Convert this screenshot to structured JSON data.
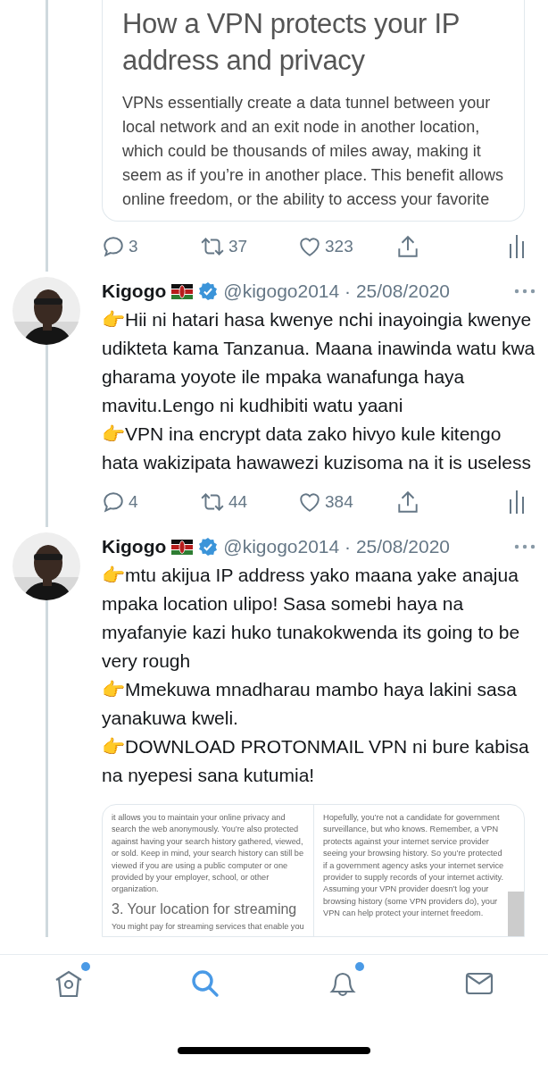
{
  "top_post": {
    "card": {
      "title": "How a VPN protects your IP address and privacy",
      "body": "VPNs essentially create a data tunnel between your local network and an exit node in another location, which could be thousands of miles away, making it seem as if you’re in another place. This benefit allows online freedom, or the ability to access your favorite"
    },
    "actions": {
      "replies": "3",
      "retweets": "37",
      "likes": "323"
    }
  },
  "tweets": [
    {
      "name": "Kigogo",
      "verified": true,
      "handle": "@kigogo2014",
      "separator": "·",
      "date": "25/08/2020",
      "paragraphs": [
        "👉Hii ni hatari hasa kwenye nchi inayoingia kwenye udikteta kama Tanzanua. Maana inawinda watu kwa gharama yoyote ile mpaka wanafunga haya mavitu.Lengo ni kudhibiti watu yaani",
        "👉VPN ina encrypt data zako hivyo kule kitengo hata wakizipata hawawezi kuzisoma na it is useless"
      ],
      "actions": {
        "replies": "4",
        "retweets": "44",
        "likes": "384"
      }
    },
    {
      "name": "Kigogo",
      "verified": true,
      "handle": "@kigogo2014",
      "separator": "·",
      "date": "25/08/2020",
      "paragraphs": [
        "👉mtu akijua IP address yako maana yake anajua mpaka location ulipo! Sasa somebi haya na myafanyie kazi huko tunakokwenda its going to be very rough",
        "👉Mmekuwa mnadharau mambo haya lakini sasa yanakuwa kweli.",
        "👉DOWNLOAD PROTONMAIL VPN ni bure kabisa na nyepesi sana kutumia!"
      ],
      "media": [
        {
          "blocks": [
            {
              "kind": "text",
              "text": "it allows you to maintain your online privacy and search the web anonymously. You’re also protected against having your search history gathered, viewed, or sold. Keep in mind, your search history can still be viewed if you are using a public computer or one provided by your employer, school, or other organization."
            },
            {
              "kind": "heading",
              "text": "3. Your location for streaming"
            },
            {
              "kind": "text",
              "text": "You might pay for streaming services that enable you"
            }
          ]
        },
        {
          "blocks": [
            {
              "kind": "text",
              "text": "Hopefully, you’re not a candidate for government surveillance, but who knows. Remember, a VPN protects against your internet service provider seeing your browsing history. So you’re protected if a government agency asks your internet service provider to supply records of your internet activity. Assuming your VPN provider doesn’t log your browsing history (some VPN providers do), your VPN can help protect your internet freedom."
            }
          ]
        }
      ]
    }
  ],
  "tab_bar": [
    {
      "kind": "home",
      "selected": false,
      "badge": true
    },
    {
      "kind": "search",
      "selected": true,
      "badge": false
    },
    {
      "kind": "notifications",
      "selected": false,
      "badge": true
    },
    {
      "kind": "messages",
      "selected": false,
      "badge": false
    }
  ]
}
